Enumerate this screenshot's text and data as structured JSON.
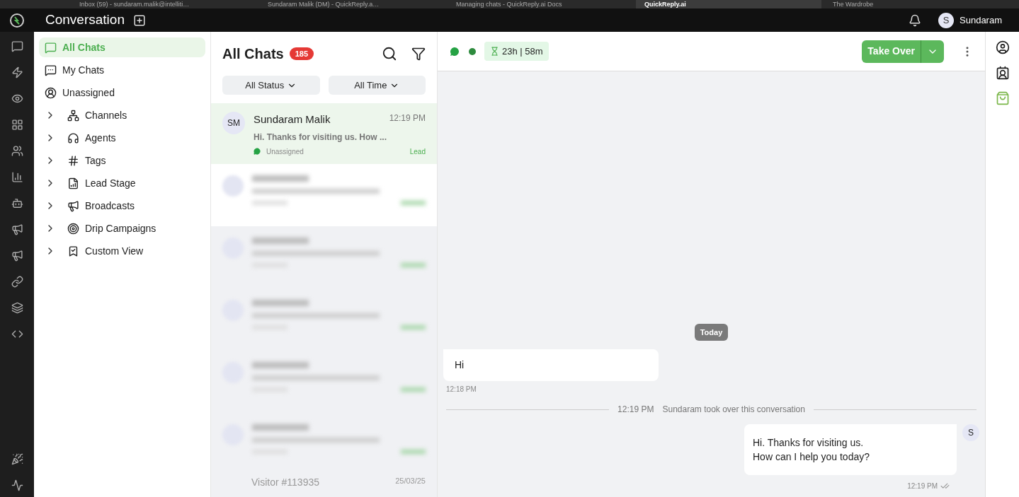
{
  "browser_tabs": [
    {
      "label": "Inbox (59) - sundaram.malik@intelliti…",
      "selected": false
    },
    {
      "label": "Sundaram Malik (DM) - QuickReply.a…",
      "selected": false
    },
    {
      "label": "Managing chats - QuickReply.ai Docs",
      "selected": false
    },
    {
      "label": "QuickReply.ai",
      "selected": true
    },
    {
      "label": "The Wardrobe",
      "selected": false
    }
  ],
  "header": {
    "title": "Conversation",
    "user_initial": "S",
    "user_name": "Sundaram"
  },
  "nav": [
    {
      "label": "All Chats",
      "kind": "link",
      "selected": true
    },
    {
      "label": "My Chats",
      "kind": "link",
      "selected": false
    },
    {
      "label": "Unassigned",
      "kind": "link",
      "selected": false
    },
    {
      "label": "Channels",
      "kind": "group",
      "selected": false
    },
    {
      "label": "Agents",
      "kind": "group",
      "selected": false
    },
    {
      "label": "Tags",
      "kind": "group",
      "selected": false
    },
    {
      "label": "Lead Stage",
      "kind": "group",
      "selected": false
    },
    {
      "label": "Broadcasts",
      "kind": "group",
      "selected": false
    },
    {
      "label": "Drip Campaigns",
      "kind": "group",
      "selected": false
    },
    {
      "label": "Custom View",
      "kind": "group",
      "selected": false
    }
  ],
  "chat_list": {
    "title": "All Chats",
    "count": "185",
    "filters": [
      "All Status",
      "All Time"
    ],
    "chats": [
      {
        "initials": "SM",
        "name": "Sundaram Malik",
        "time": "12:19 PM",
        "preview": "Hi. Thanks for visiting us. How ...",
        "assignee": "Unassigned",
        "stage": "Lead",
        "selected": true
      }
    ],
    "partial_row": {
      "name": "Visitor #113935",
      "time": "25/03/25"
    }
  },
  "conversation": {
    "online": true,
    "timer": "23h | 58m",
    "take_over": "Take Over",
    "messages": [
      {
        "kind": "date",
        "text": "Today"
      },
      {
        "kind": "incoming",
        "text": "Hi",
        "time": "12:18 PM"
      },
      {
        "kind": "event",
        "time": "12:19 PM",
        "text": "Sundaram took over this conversation"
      },
      {
        "kind": "outgoing",
        "text": "Hi. Thanks for visiting us.\nHow can I help you today?",
        "time": "12:19 PM",
        "avatar": "S"
      }
    ]
  }
}
